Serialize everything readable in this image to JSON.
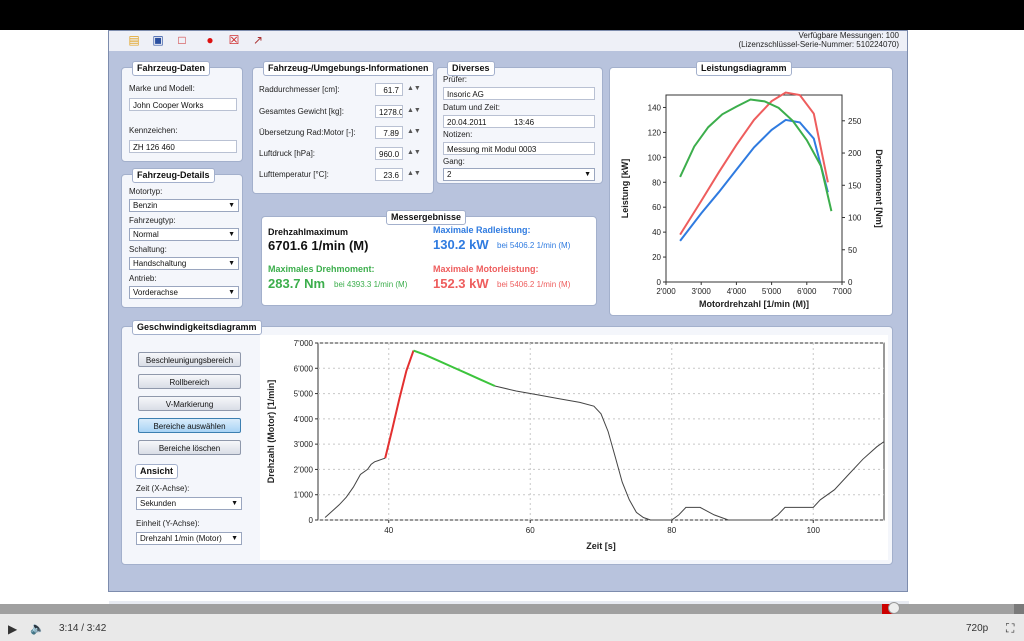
{
  "app": {
    "license_line1": "Verfügbare Messungen: 100",
    "license_line2": "(Lizenzschlüssel-Serie-Nummer: 510224070)"
  },
  "fahrzeug_daten": {
    "title": "Fahrzeug-Daten",
    "marke_label": "Marke und Modell:",
    "marke_value": "John Cooper Works",
    "kennzeichen_label": "Kennzeichen:",
    "kennzeichen_value": "ZH 126 460"
  },
  "fahrzeug_details": {
    "title": "Fahrzeug-Details",
    "motortyp_label": "Motortyp:",
    "motortyp_value": "Benzin",
    "fahrzeugtyp_label": "Fahrzeugtyp:",
    "fahrzeugtyp_value": "Normal",
    "schaltung_label": "Schaltung:",
    "schaltung_value": "Handschaltung",
    "antrieb_label": "Antrieb:",
    "antrieb_value": "Vorderachse"
  },
  "umgebung": {
    "title": "Fahrzeug-/Umgebungs-Informationen",
    "rows": [
      {
        "label": "Raddurchmesser [cm]:",
        "value": "61.7"
      },
      {
        "label": "Gesamtes Gewicht [kg]:",
        "value": "1278.0"
      },
      {
        "label": "Übersetzung Rad:Motor [-]:",
        "value": "7.89"
      },
      {
        "label": "Luftdruck [hPa]:",
        "value": "960.0"
      },
      {
        "label": "Lufttemperatur [°C]:",
        "value": "23.6"
      }
    ]
  },
  "diverses": {
    "title": "Diverses",
    "pruefer_label": "Prüfer:",
    "pruefer_value": "Insoric AG",
    "datum_label": "Datum und Zeit:",
    "datum_value": "20.04.2011",
    "zeit_value": "13:46",
    "notizen_label": "Notizen:",
    "notizen_value": "Messung mit Modul 0003",
    "gang_label": "Gang:",
    "gang_value": "2"
  },
  "messergebnisse": {
    "title": "Messergebnisse",
    "drehzahl_label": "Drehzahlmaximum",
    "drehzahl_value": "6701.6 1/min (M)",
    "radleistung_label": "Maximale Radleistung:",
    "radleistung_value": "130.2 kW",
    "radleistung_at": "bei 5406.2 1/min (M)",
    "drehmoment_label": "Maximales Drehmoment:",
    "drehmoment_value": "283.7 Nm",
    "drehmoment_at": "bei 4393.3 1/min (M)",
    "motorleistung_label": "Maximale Motorleistung:",
    "motorleistung_value": "152.3 kW",
    "motorleistung_at": "bei 5406.2 1/min (M)"
  },
  "geschw": {
    "title": "Geschwindigkeitsdiagramm",
    "buttons": [
      "Beschleunigungsbereich",
      "Rollbereich",
      "V-Markierung",
      "Bereiche auswählen",
      "Bereiche löschen"
    ],
    "ansicht_title": "Ansicht",
    "zeit_label": "Zeit (X-Achse):",
    "zeit_value": "Sekunden",
    "einheit_label": "Einheit (Y-Achse):",
    "einheit_value": "Drehzahl 1/min (Motor)"
  },
  "player": {
    "time": "3:14 / 3:42",
    "quality": "720p",
    "progress_fraction": 0.873,
    "buffered_fraction": 0.99
  },
  "chart_data": [
    {
      "type": "line",
      "title": "Leistungsdiagramm",
      "xlabel": "Motordrehzahl [1/min (M)]",
      "ylabel": "Leistung [kW]",
      "y2label": "Drehmoment [Nm]",
      "xlim": [
        2000,
        7000
      ],
      "ylim": [
        0,
        150
      ],
      "y2lim": [
        0,
        290
      ],
      "xticks": [
        "2'000",
        "3'000",
        "4'000",
        "5'000",
        "6'000",
        "7'000"
      ],
      "yticks": [
        "0",
        "20",
        "40",
        "60",
        "80",
        "100",
        "120",
        "140"
      ],
      "y2ticks": [
        "0",
        "50",
        "100",
        "150",
        "200",
        "250"
      ],
      "series": [
        {
          "axis": "y",
          "color": "#2f7be0",
          "x": [
            2400,
            3000,
            3500,
            4000,
            4500,
            5000,
            5400,
            5800,
            6200,
            6600
          ],
          "y": [
            33,
            55,
            72,
            90,
            108,
            122,
            130,
            128,
            115,
            72
          ]
        },
        {
          "axis": "y",
          "color": "#ee5d5d",
          "x": [
            2400,
            3000,
            3500,
            4000,
            4500,
            5000,
            5400,
            5800,
            6200,
            6600
          ],
          "y": [
            38,
            65,
            88,
            110,
            130,
            145,
            152,
            150,
            135,
            80
          ]
        },
        {
          "axis": "y2",
          "color": "#3cae4c",
          "x": [
            2400,
            2800,
            3200,
            3600,
            4000,
            4400,
            4800,
            5200,
            5600,
            6000,
            6400,
            6700
          ],
          "y": [
            163,
            210,
            240,
            260,
            272,
            283,
            280,
            270,
            250,
            220,
            180,
            110
          ]
        }
      ]
    },
    {
      "type": "line",
      "xlabel": "Zeit [s]",
      "ylabel": "Drehzahl (Motor) [1/min]",
      "xlim": [
        30,
        110
      ],
      "ylim": [
        0,
        7000
      ],
      "xticks": [
        "40",
        "60",
        "80",
        "100"
      ],
      "yticks": [
        "0",
        "1'000",
        "2'000",
        "3'000",
        "4'000",
        "5'000",
        "6'000",
        "7'000"
      ],
      "series": [
        {
          "color": "#444444",
          "x": [
            31,
            33,
            34,
            35,
            36,
            37,
            37.5,
            38,
            38.5,
            39,
            39.5
          ],
          "y": [
            100,
            600,
            900,
            1300,
            1800,
            2000,
            2200,
            2300,
            2350,
            2400,
            2450
          ]
        },
        {
          "color": "#e33030",
          "x": [
            39.5,
            40.5,
            41.5,
            42.5,
            43.5
          ],
          "y": [
            2450,
            3600,
            4800,
            5900,
            6700
          ]
        },
        {
          "color": "#3cc43c",
          "x": [
            43.5,
            45,
            47,
            49,
            51,
            53,
            55
          ],
          "y": [
            6700,
            6550,
            6300,
            6050,
            5800,
            5550,
            5300
          ]
        },
        {
          "color": "#444444",
          "x": [
            55,
            58,
            61,
            64,
            67,
            69,
            70,
            71,
            72,
            73,
            74,
            75,
            76,
            77,
            78,
            79,
            80,
            81,
            82,
            84,
            86,
            88,
            90,
            92,
            94,
            95,
            96,
            98,
            100,
            101,
            103,
            105,
            107,
            109,
            110
          ],
          "y": [
            5300,
            5100,
            4950,
            4800,
            4650,
            4500,
            4200,
            3500,
            2500,
            1500,
            800,
            300,
            100,
            0,
            0,
            0,
            0,
            200,
            500,
            500,
            200,
            0,
            0,
            0,
            0,
            200,
            500,
            500,
            500,
            800,
            1200,
            1800,
            2400,
            2900,
            3100
          ]
        }
      ]
    }
  ]
}
